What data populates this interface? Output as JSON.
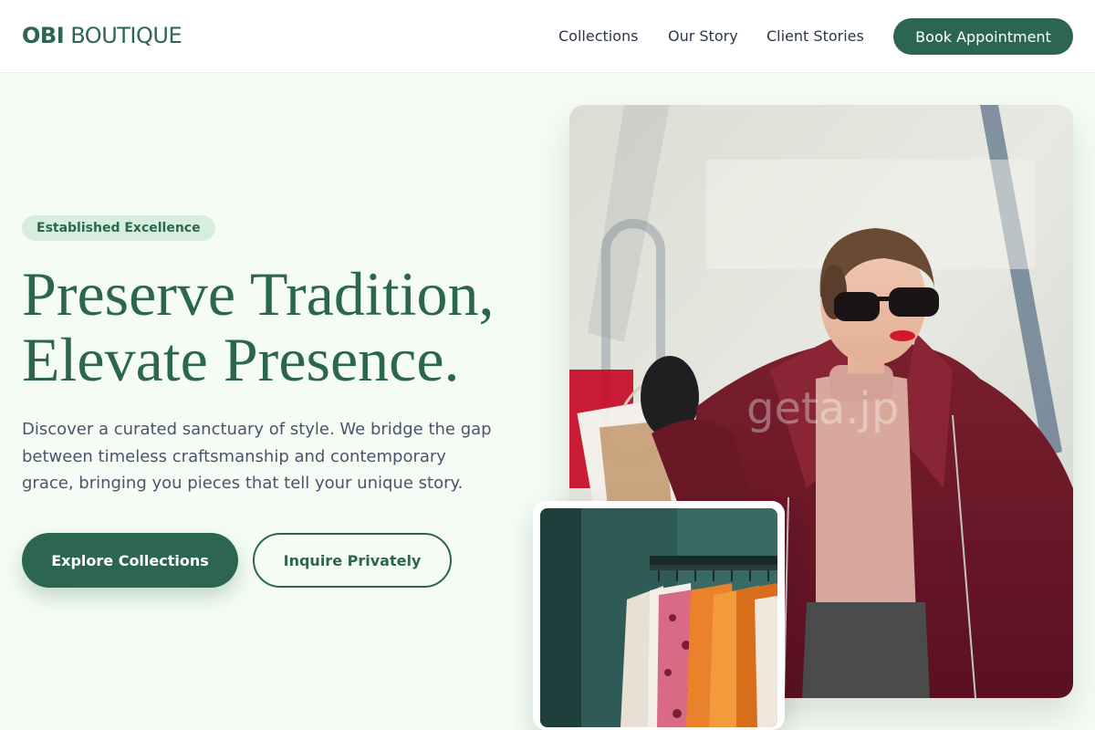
{
  "header": {
    "logo_bold": "OBI",
    "logo_rest": "BOUTIQUE",
    "nav": {
      "collections": "Collections",
      "our_story": "Our Story",
      "client_stories": "Client Stories"
    },
    "cta": "Book Appointment"
  },
  "hero": {
    "badge": "Established Excellence",
    "headline_line1": "Preserve Tradition,",
    "headline_line2": "Elevate Presence.",
    "description": "Discover a curated sanctuary of style. We bridge the gap between timeless craftsmanship and contemporary grace, bringing you pieces that tell your unique story.",
    "primary_button": "Explore Collections",
    "secondary_button": "Inquire Privately"
  },
  "images": {
    "main_watermark": "geta.jp"
  },
  "colors": {
    "brand": "#2c6650",
    "badge_bg": "#d8eedd",
    "page_bg": "#f5fcf6"
  }
}
